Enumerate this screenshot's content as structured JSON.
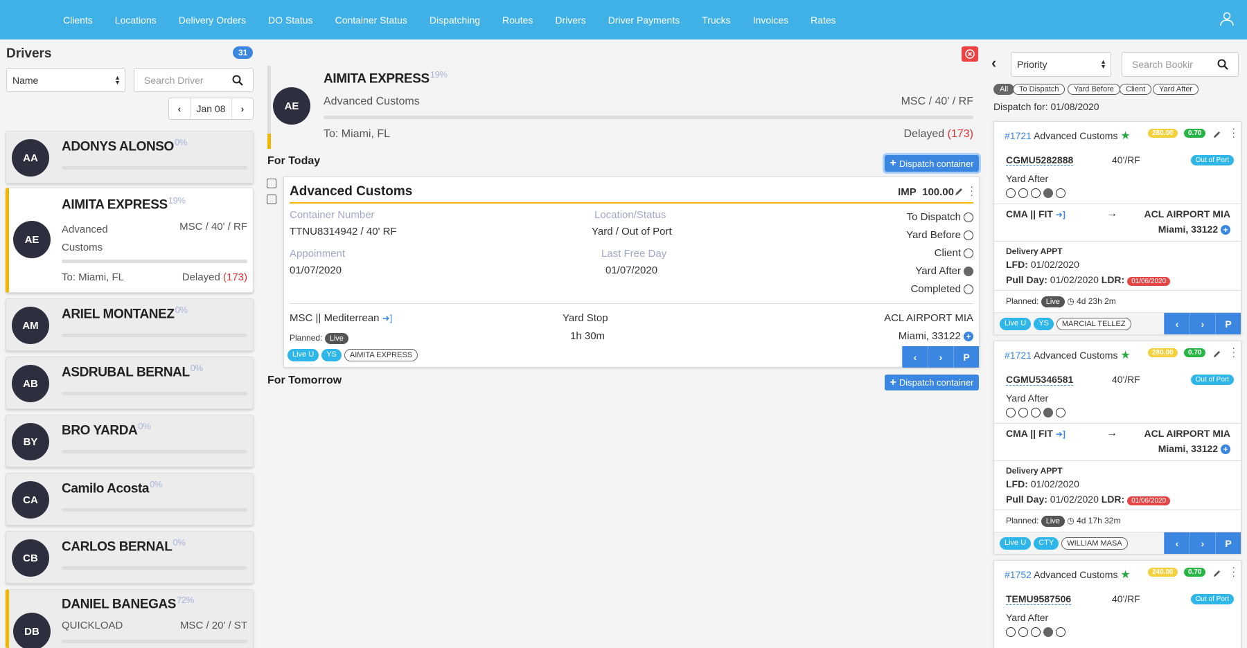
{
  "nav": {
    "items": [
      "Clients",
      "Locations",
      "Delivery Orders",
      "DO Status",
      "Container Status",
      "Dispatching",
      "Routes",
      "Drivers",
      "Driver Payments",
      "Trucks",
      "Invoices",
      "Rates"
    ],
    "user_icon": "user-icon"
  },
  "drivers_panel": {
    "title": "Drivers",
    "count": "31",
    "sort_select": "Name",
    "search_placeholder": "Search Driver",
    "date": "Jan 08",
    "drivers": [
      {
        "initials": "AA",
        "name": "ADONYS ALONSO",
        "pct": "0%"
      },
      {
        "initials": "AE",
        "name": "AIMITA EXPRESS",
        "pct": "19%",
        "client": "Advanced Customs",
        "route": "MSC / 40' / RF",
        "to": "To: Miami, FL",
        "status": "Delayed",
        "delay": "(173)"
      },
      {
        "initials": "AM",
        "name": "ARIEL MONTANEZ",
        "pct": "0%"
      },
      {
        "initials": "AB",
        "name": "ASDRUBAL BERNAL",
        "pct": "0%"
      },
      {
        "initials": "BY",
        "name": "BRO YARDA",
        "pct": "0%"
      },
      {
        "initials": "CA",
        "name": "Camilo Acosta",
        "pct": "0%"
      },
      {
        "initials": "CB",
        "name": "CARLOS BERNAL",
        "pct": "0%"
      },
      {
        "initials": "DB",
        "name": "DANIEL BANEGAS",
        "pct": "72%",
        "client": "QUICKLOAD",
        "route": "MSC / 20' / ST"
      }
    ]
  },
  "detail": {
    "initials": "AE",
    "name": "AIMITA EXPRESS",
    "pct": "19%",
    "client": "Advanced Customs",
    "route": "MSC / 40' / RF",
    "to": "To: Miami, FL",
    "status": "Delayed",
    "delay": "(173)",
    "for_today": "For Today",
    "for_tomorrow": "For Tomorrow",
    "dispatch_label": "Dispatch container",
    "card": {
      "client": "Advanced Customs",
      "type": "IMP",
      "amount": "100.00",
      "container_number_label": "Container Number",
      "container_number": "TTNU8314942 / 40' RF",
      "location_label": "Location/Status",
      "location": "Yard / Out of Port",
      "appointment_label": "Appoinment",
      "appointment": "01/07/2020",
      "lfd_label": "Last Free Day",
      "lfd": "01/07/2020",
      "statuses": [
        {
          "label": "To Dispatch",
          "on": false
        },
        {
          "label": "Yard Before",
          "on": false
        },
        {
          "label": "Client",
          "on": false
        },
        {
          "label": "Yard After",
          "on": true
        },
        {
          "label": "Completed",
          "on": false
        }
      ],
      "origin": "MSC || Mediterrean",
      "planned_label": "Planned:",
      "planned": "Live",
      "stop": "Yard Stop",
      "stop_time": "1h 30m",
      "dest": "ACL AIRPORT MIA",
      "dest_city": "Miami, 33122",
      "tags": [
        "Live U",
        "YS"
      ],
      "driver_tag": "AIMITA EXPRESS",
      "nav_p": "P"
    }
  },
  "dispatch_panel": {
    "priority_select": "Priority",
    "search_placeholder": "Search Bookir",
    "filters": [
      "All",
      "To Dispatch",
      "Yard Before",
      "Client",
      "Yard After"
    ],
    "dispatch_for": "Dispatch for: 01/08/2020",
    "cards": [
      {
        "num": "#1721",
        "client": "Advanced Customs",
        "price": "280.00",
        "rate": "0.70",
        "container": "CGMU5282888",
        "size": "40'/RF",
        "port": "Out of Port",
        "stage": "Yard After",
        "from": "CMA || FIT",
        "to": "ACL AIRPORT MIA",
        "city": "Miami, 33122",
        "appt": "Delivery APPT",
        "lfd_label": "LFD:",
        "lfd": "01/02/2020",
        "pull_label": "Pull Day:",
        "pull": "01/02/2020",
        "ldr_label": "LDR:",
        "ldr": "01/06/2020",
        "planned_label": "Planned:",
        "planned": "Live",
        "eta": "4d 23h 2m",
        "tags": [
          "Live U",
          "YS"
        ],
        "driver": "MARCIAL TELLEZ",
        "p": "P"
      },
      {
        "num": "#1721",
        "client": "Advanced Customs",
        "price": "280.00",
        "rate": "0.70",
        "container": "CGMU5346581",
        "size": "40'/RF",
        "port": "Out of Port",
        "stage": "Yard After",
        "from": "CMA || FIT",
        "to": "ACL AIRPORT MIA",
        "city": "Miami, 33122",
        "appt": "Delivery APPT",
        "lfd_label": "LFD:",
        "lfd": "01/02/2020",
        "pull_label": "Pull Day:",
        "pull": "01/02/2020",
        "ldr_label": "LDR:",
        "ldr": "01/06/2020",
        "planned_label": "Planned:",
        "planned": "Live",
        "eta": "4d 17h 32m",
        "tags": [
          "Live U",
          "CTY"
        ],
        "driver": "WILLIAM MASA",
        "p": "P"
      },
      {
        "num": "#1752",
        "client": "Advanced Customs",
        "price": "240.00",
        "rate": "0.70",
        "container": "TEMU9587506",
        "size": "40'/RF",
        "port": "Out of Port",
        "stage": "Yard After"
      }
    ]
  },
  "colors": {
    "topbar": "#3fb1e7",
    "accent": "#3a86e0",
    "delay": "#e03131",
    "progress_marker": "#f3b600"
  }
}
